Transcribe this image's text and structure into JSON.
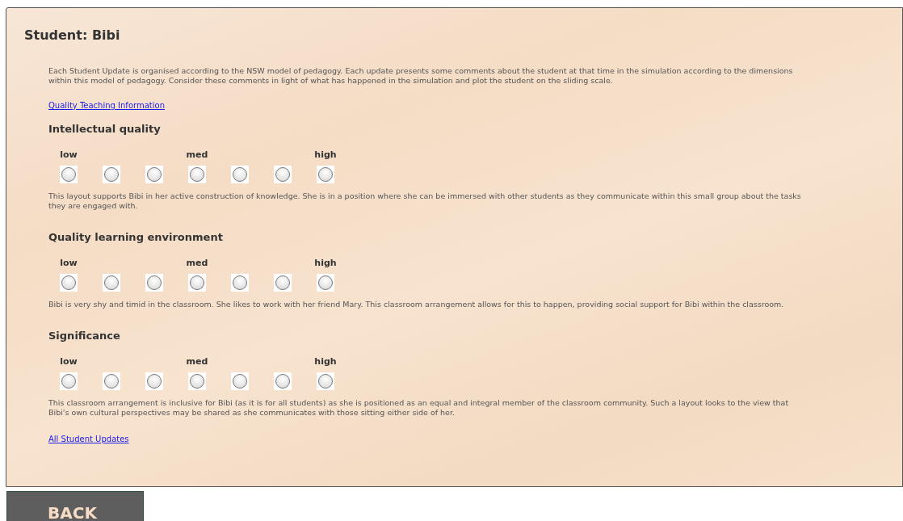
{
  "title": "Student: Bibi",
  "intro": "Each Student Update is organised according to the NSW model of pedagogy. Each update presents some comments about the student at that time in the simulation according to the dimensions within this model of pedagogy. Consider these comments in light of what has happened in the simulation and plot the student on the sliding scale.",
  "info_link": "Quality Teaching Information",
  "sections": [
    {
      "heading": "Intellectual quality",
      "options": [
        {
          "label": "low",
          "selected": false
        },
        {
          "selected": false
        },
        {
          "selected": false
        },
        {
          "label": "med",
          "selected": false
        },
        {
          "selected": false
        },
        {
          "selected": false
        },
        {
          "label": "high",
          "selected": false
        }
      ],
      "comment": "This layout supports Bibi in her active construction of knowledge. She is in a position where she can be immersed with other students as they communicate within this small group about the tasks they are engaged with."
    },
    {
      "heading": "Quality learning environment",
      "options": [
        {
          "label": "low",
          "selected": false
        },
        {
          "selected": false
        },
        {
          "selected": false
        },
        {
          "label": "med",
          "selected": false
        },
        {
          "selected": false
        },
        {
          "selected": false
        },
        {
          "label": "high",
          "selected": false
        }
      ],
      "comment": "Bibi is very shy and timid in the classroom. She likes to work with her friend Mary. This classroom arrangement allows for this to happen, providing social support for Bibi within the classroom."
    },
    {
      "heading": "Significance",
      "options": [
        {
          "label": "low",
          "selected": false
        },
        {
          "selected": false
        },
        {
          "selected": false
        },
        {
          "label": "med",
          "selected": false
        },
        {
          "selected": false
        },
        {
          "selected": false
        },
        {
          "label": "high",
          "selected": false
        }
      ],
      "comment": "This classroom arrangement is inclusive for Bibi (as it is for all students) as she is positioned as an equal and integral member of the classroom community. Such a layout looks to the view that Bibi's own cultural perspectives may be shared as she communicates with those sitting either side of her."
    }
  ],
  "updates_link": "All Student Updates",
  "back_button": "BACK"
}
